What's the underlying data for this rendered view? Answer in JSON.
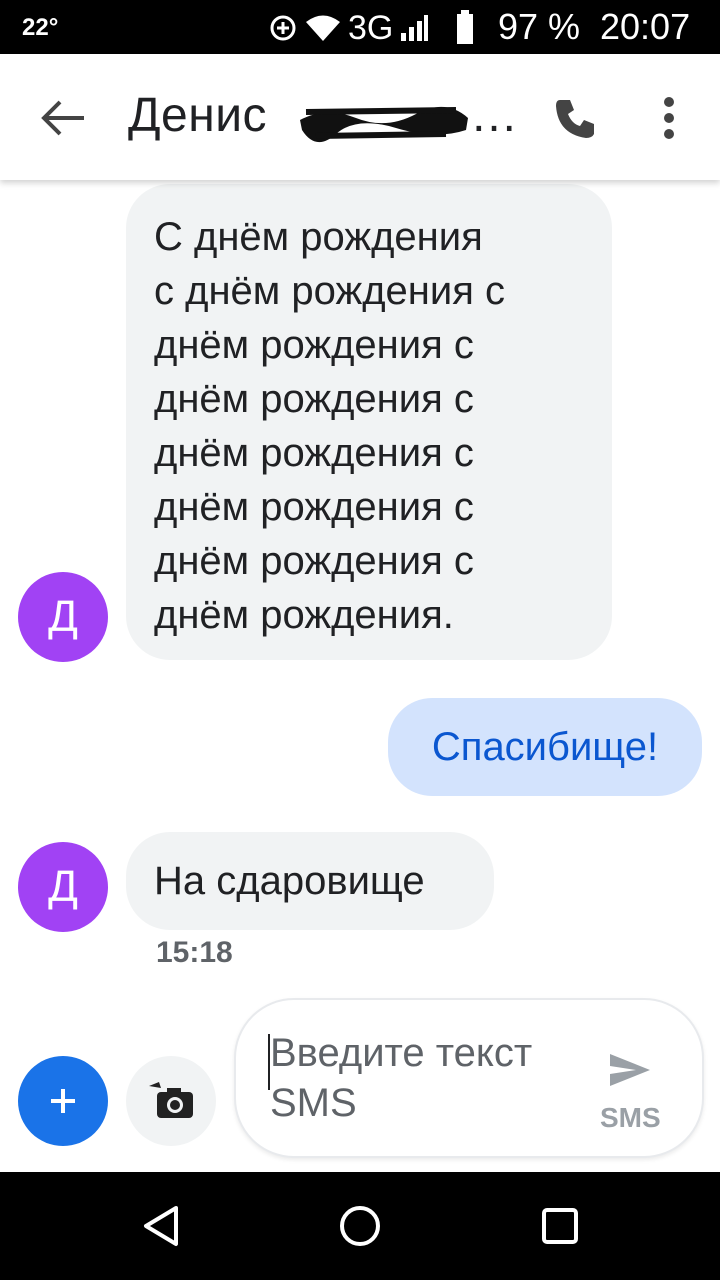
{
  "status_bar": {
    "temperature": "22°",
    "network": "3G",
    "battery": "97 %",
    "time": "20:07",
    "icons": [
      "data-saver-icon",
      "wifi-icon",
      "signal-icon",
      "battery-icon"
    ]
  },
  "app_bar": {
    "contact_name": "Денис",
    "ellipsis": "…",
    "icons": [
      "back-arrow-icon",
      "phone-icon",
      "more-vert-icon"
    ]
  },
  "messages": [
    {
      "direction": "incoming",
      "avatar": "Д",
      "lines": [
        "С днём рождения",
        "с днём рождения с",
        "днём рождения с",
        "днём рождения с",
        "днём рождения с",
        "днём рождения с",
        "днём рождения с",
        "днём рождения."
      ]
    },
    {
      "direction": "outgoing",
      "text": "Спасибище!"
    },
    {
      "direction": "incoming",
      "avatar": "Д",
      "text": "На сдаровище",
      "time": "15:18"
    }
  ],
  "compose": {
    "placeholder_line1": "Введите текст",
    "placeholder_line2": "SMS",
    "send_label": "SMS"
  },
  "colors": {
    "avatar": "#a142f4",
    "incoming_bubble": "#f1f3f4",
    "outgoing_bubble": "#d3e3fd",
    "outgoing_text": "#0b57d0",
    "fab": "#1a73e8"
  }
}
